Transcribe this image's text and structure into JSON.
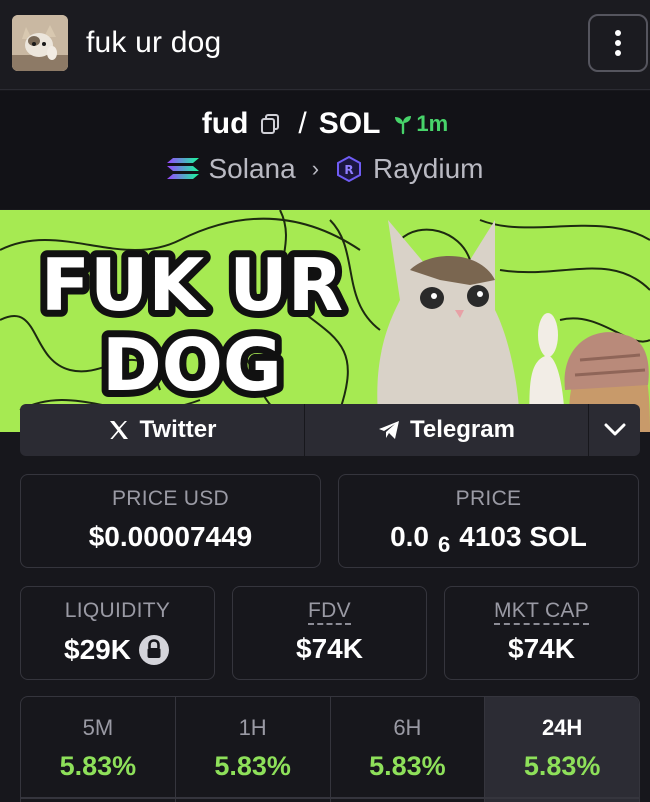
{
  "header": {
    "title": "fuk ur dog",
    "menu_icon": "more-vertical-icon"
  },
  "pair": {
    "base": "fud",
    "quote": "SOL",
    "separator": "/",
    "age": "1m",
    "chain": "Solana",
    "dex": "Raydium"
  },
  "banner": {
    "text_line1": "FUK UR",
    "text_line2": "DOG"
  },
  "socials": {
    "twitter": "Twitter",
    "telegram": "Telegram"
  },
  "stats": {
    "price_usd_label": "PRICE USD",
    "price_usd": "$0.00007449",
    "price_label": "PRICE",
    "price_prefix": "0.0",
    "price_sub": "6",
    "price_suffix": "4103 SOL",
    "liquidity_label": "LIQUIDITY",
    "liquidity": "$29K",
    "fdv_label": "FDV",
    "fdv": "$74K",
    "mcap_label": "MKT CAP",
    "mcap": "$74K"
  },
  "timeframes": [
    {
      "label": "5M",
      "value": "5.83%"
    },
    {
      "label": "1H",
      "value": "5.83%"
    },
    {
      "label": "6H",
      "value": "5.83%"
    },
    {
      "label": "24H",
      "value": "5.83%"
    }
  ],
  "colors": {
    "accent_green": "#8ee05a",
    "age_green": "#47d36a",
    "banner_green": "#a6ea52",
    "background": "#17171c"
  }
}
